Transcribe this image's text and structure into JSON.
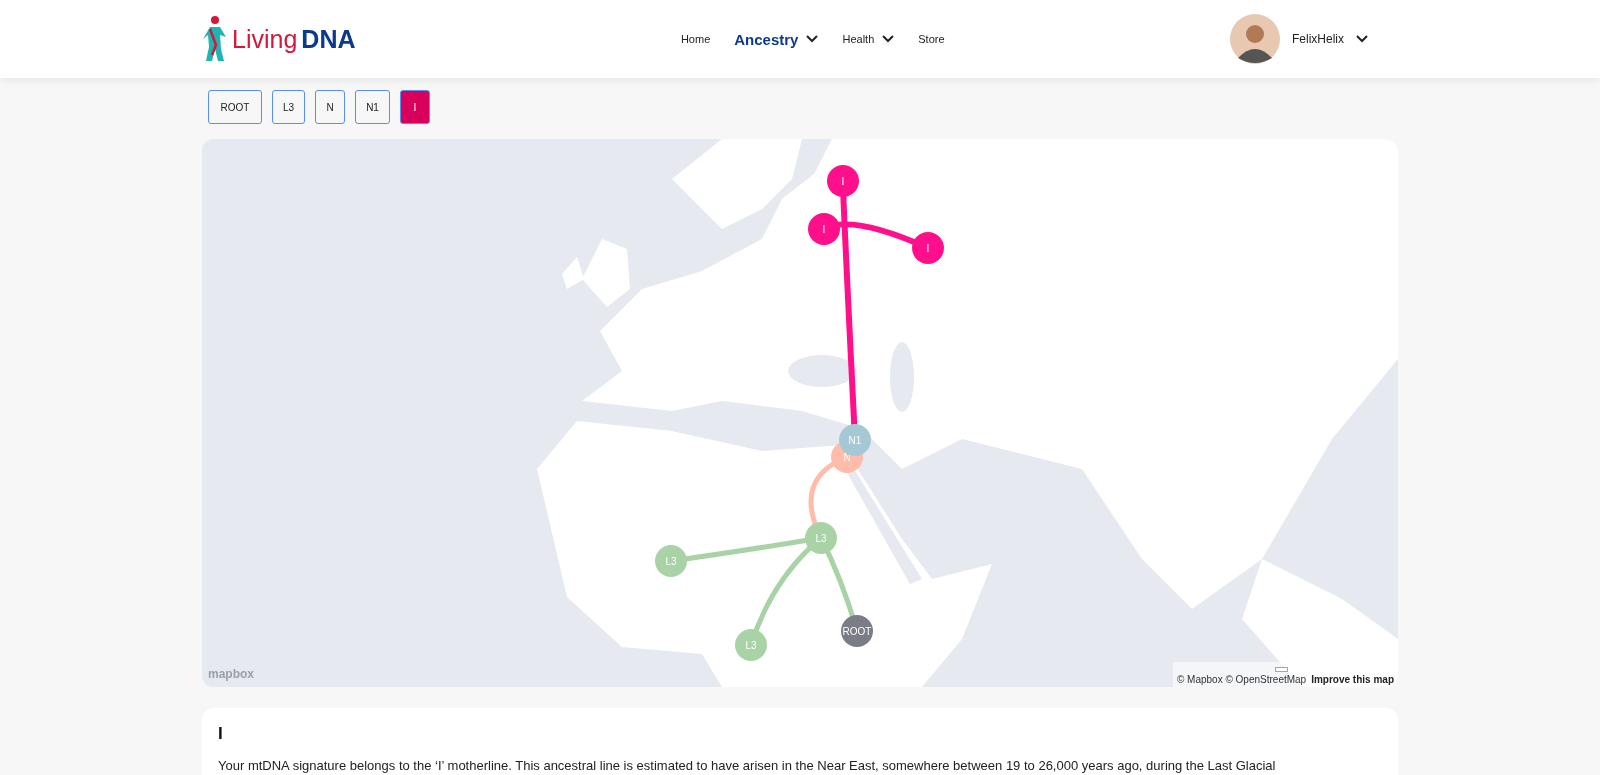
{
  "header": {
    "logo": {
      "word_1": "Living",
      "word_2": "DNA"
    },
    "nav": [
      {
        "label": "Home",
        "selected": false,
        "has_menu": false
      },
      {
        "label": "Ancestry",
        "selected": true,
        "has_menu": true
      },
      {
        "label": "Health",
        "selected": false,
        "has_menu": true
      },
      {
        "label": "Store",
        "selected": false,
        "has_menu": false
      }
    ],
    "user": {
      "name": "FelixHelix"
    }
  },
  "lineage_tabs": [
    {
      "label": "ROOT",
      "selected": false
    },
    {
      "label": "L3",
      "selected": false
    },
    {
      "label": "N",
      "selected": false
    },
    {
      "label": "N1",
      "selected": false
    },
    {
      "label": "I",
      "selected": true
    }
  ],
  "map": {
    "markers": [
      {
        "label": "I",
        "color": "#ff0f8b"
      },
      {
        "label": "I",
        "color": "#ff0f8b"
      },
      {
        "label": "I",
        "color": "#ff0f8b"
      },
      {
        "label": "N",
        "color": "#ffbcaa"
      },
      {
        "label": "N1",
        "color": "#a6c8d4"
      },
      {
        "label": "L3",
        "color": "#a9d3a6"
      },
      {
        "label": "L3",
        "color": "#a9d3a6"
      },
      {
        "label": "L3",
        "color": "#a9d3a6"
      },
      {
        "label": "ROOT",
        "color": "#7b7d86"
      }
    ],
    "logo_text": "mapbox",
    "attribution": "© Mapbox © OpenStreetMap",
    "improve_link": "Improve this map"
  },
  "detail": {
    "title": "I",
    "text": "Your mtDNA signature belongs to the ‘I’ motherline. This ancestral line is estimated to have arisen in the Near East, somewhere between 19 to 26,000 years ago, during the Last Glacial"
  }
}
